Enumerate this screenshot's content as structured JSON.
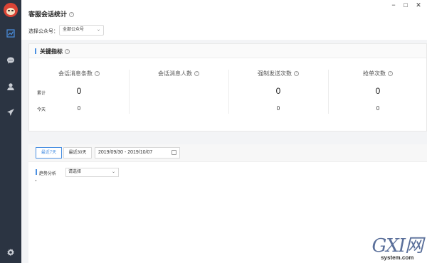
{
  "app": {
    "title": "客服会话统计",
    "help": "?",
    "window": {
      "minimize": "−",
      "maximize": "□",
      "close": "✕"
    }
  },
  "sidebar": {
    "items": [
      {
        "icon": "chart-icon",
        "active": true
      },
      {
        "icon": "chat-icon",
        "active": false
      },
      {
        "icon": "user-icon",
        "active": false
      },
      {
        "icon": "send-icon",
        "active": false
      }
    ],
    "settings_icon": "gear-icon"
  },
  "filter": {
    "label": "选择公众号：",
    "selected": "全部公众号"
  },
  "metrics_card": {
    "title": "关键指标",
    "row_labels": {
      "total": "累计",
      "today": "今天"
    },
    "metrics": [
      {
        "label": "会话消息条数",
        "total": "0",
        "today": "0"
      },
      {
        "label": "会话消息人数",
        "total": "",
        "today": ""
      },
      {
        "label": "强制发送次数",
        "total": "0",
        "today": "0"
      },
      {
        "label": "抢单次数",
        "total": "0",
        "today": "0"
      }
    ]
  },
  "range": {
    "tabs": [
      "最近7天",
      "最近30天"
    ],
    "active_tab": 0,
    "date_range": "2019/09/30 - 2019/10/07"
  },
  "trend": {
    "label": "趋势分析",
    "select_value": "请选择"
  },
  "watermark": {
    "big": "GXI网",
    "small": "system.com"
  },
  "colors": {
    "accent": "#4a90e2",
    "sidebar": "#2b3442"
  }
}
